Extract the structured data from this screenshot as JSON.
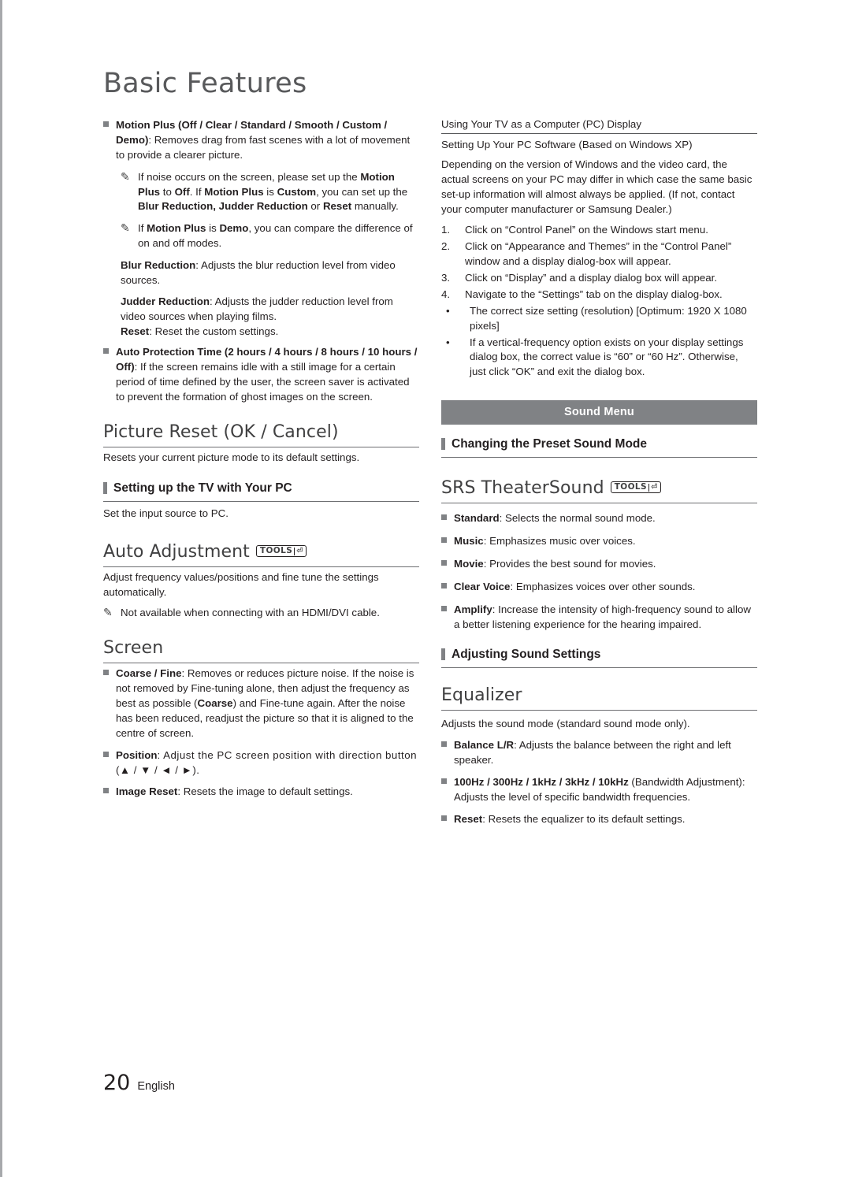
{
  "page": {
    "title": "Basic Features",
    "footer_number": "20",
    "footer_lang": "English"
  },
  "left": {
    "motion_plus": {
      "head_bold": "Motion Plus (Off / Clear / Standard / Smooth / Custom / Demo)",
      "head_rest": ": Removes drag from fast scenes with a lot of movement to provide a clearer picture."
    },
    "note1": "If noise occurs on the screen, please set up the Motion Plus to Off. If Motion Plus is Custom, you can set up the Blur Reduction, Judder Reduction or Reset manually.",
    "note2": "If Motion Plus is Demo, you can compare the difference of on and off modes.",
    "blur_reduction": {
      "label": "Blur Reduction",
      "text": ": Adjusts the blur reduction level from video sources."
    },
    "judder_reduction": {
      "label": "Judder Reduction",
      "text": ": Adjusts the judder reduction level from video sources when playing films."
    },
    "reset": {
      "label": "Reset",
      "text": ": Reset the custom settings."
    },
    "auto_protection": {
      "bold": "Auto Protection Time (2 hours / 4 hours / 8 hours / 10 hours / Off)",
      "rest": ": If the screen remains idle with a still image for a certain period of time defined by the user, the screen saver is activated to prevent the formation of ghost images on the screen."
    },
    "picture_reset_heading": "Picture Reset (OK / Cancel)",
    "picture_reset_text": "Resets your current picture mode to its default settings.",
    "setting_up_tv_pc_heading": "Setting up the TV with Your PC",
    "setting_up_tv_pc_text": "Set the input source to PC.",
    "auto_adjustment_heading": "Auto Adjustment",
    "auto_adjustment_text": "Adjust frequency values/positions and fine tune the settings automatically.",
    "auto_adjustment_note": "Not available when connecting with an HDMI/DVI cable.",
    "screen_heading": "Screen",
    "coarse_fine": {
      "bold": "Coarse / Fine",
      "rest": ": Removes or reduces picture noise. If the noise is not removed by Fine-tuning alone, then adjust the frequency as best as possible (Coarse) and Fine-tune again. After the noise has been reduced, readjust the picture so that it is aligned to the centre of screen."
    },
    "position": {
      "bold": "Position",
      "rest": ": Adjust the PC screen position with direction button (▲ / ▼ / ◄ / ►)."
    },
    "image_reset": {
      "bold": "Image Reset",
      "rest": ": Resets the image to default settings."
    }
  },
  "right": {
    "pc_display_heading": "Using Your TV as a Computer (PC) Display",
    "pc_software_line": "Setting Up Your PC Software (Based on Windows XP)",
    "pc_paragraph": "Depending on the version of Windows and the video card, the actual screens on your PC may differ in which case the same basic set-up information will almost always be applied. (If not, contact your computer manufacturer or Samsung Dealer.)",
    "steps": [
      {
        "n": "1.",
        "t": "Click on “Control Panel” on the Windows start menu."
      },
      {
        "n": "2.",
        "t": "Click on “Appearance and Themes” in the “Control Panel” window and a display dialog-box will appear."
      },
      {
        "n": "3.",
        "t": "Click on “Display” and a display dialog box will appear."
      },
      {
        "n": "4.",
        "t": "Navigate to the “Settings” tab on the display dialog-box."
      }
    ],
    "dots": [
      "The correct size setting (resolution) [Optimum: 1920 X 1080 pixels]",
      "If a vertical-frequency option exists on your display settings dialog box, the correct value is “60” or “60 Hz”. Otherwise, just click “OK” and exit the dialog box."
    ],
    "sound_menu_bar": "Sound Menu",
    "changing_preset_heading": "Changing the Preset Sound Mode",
    "srs_heading": "SRS TheaterSound",
    "srs_items": [
      {
        "bold": "Standard",
        "rest": ": Selects the normal sound mode."
      },
      {
        "bold": "Music",
        "rest": ": Emphasizes music over voices."
      },
      {
        "bold": "Movie",
        "rest": ": Provides the best sound for movies."
      },
      {
        "bold": "Clear Voice",
        "rest": ": Emphasizes voices over other sounds."
      },
      {
        "bold": "Amplify",
        "rest": ": Increase the intensity of high-frequency sound to allow a better listening experience for the hearing impaired."
      }
    ],
    "adjusting_sound_heading": "Adjusting Sound Settings",
    "equalizer_heading": "Equalizer",
    "equalizer_text": "Adjusts the sound mode (standard sound mode only).",
    "equalizer_items": [
      {
        "bold": "Balance L/R",
        "rest": ": Adjusts the balance between the right and left speaker."
      },
      {
        "bold": "100Hz / 300Hz / 1kHz / 3kHz / 10kHz",
        "rest": " (Bandwidth Adjustment): Adjusts the level of specific bandwidth frequencies."
      },
      {
        "bold": "Reset",
        "rest": ": Resets the equalizer to its default settings."
      }
    ]
  },
  "icons": {
    "tools_label": "TOOLS",
    "tools_glyph": "⏎",
    "note_glyph": "✎"
  }
}
